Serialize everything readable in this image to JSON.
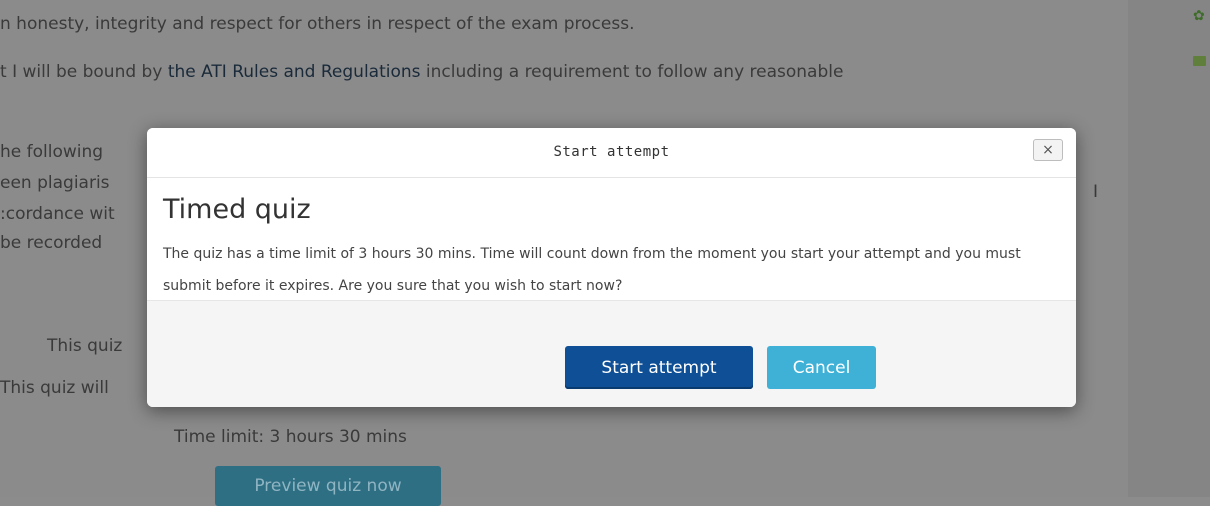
{
  "background": {
    "lines": [
      "n honesty, integrity and respect for others in respect of the exam process.",
      "t I will be bound by ",
      "the ATI Rules and Regulations",
      " including a requirement to follow any reasonable",
      "he following",
      "een plagiaris",
      ":cordance wit",
      " be recorded",
      "This quiz",
      "This quiz will",
      "I"
    ],
    "time_limit": "Time limit: 3 hours 30 mins",
    "preview_button": "Preview quiz now"
  },
  "modal": {
    "title": "Start attempt",
    "close_label": "×",
    "heading": "Timed quiz",
    "message": "The quiz has a time limit of 3 hours 30 mins. Time will count down from the moment you start your attempt and you must submit before it expires. Are you sure that you wish to start now?",
    "start_label": "Start attempt",
    "cancel_label": "Cancel"
  },
  "icons": [
    "gear-icon",
    "folder-icon",
    "close-icon"
  ],
  "colors": {
    "primary": "#0e4f96",
    "cancel": "#3fb1d6",
    "backdrop": "#8b8b8b"
  }
}
